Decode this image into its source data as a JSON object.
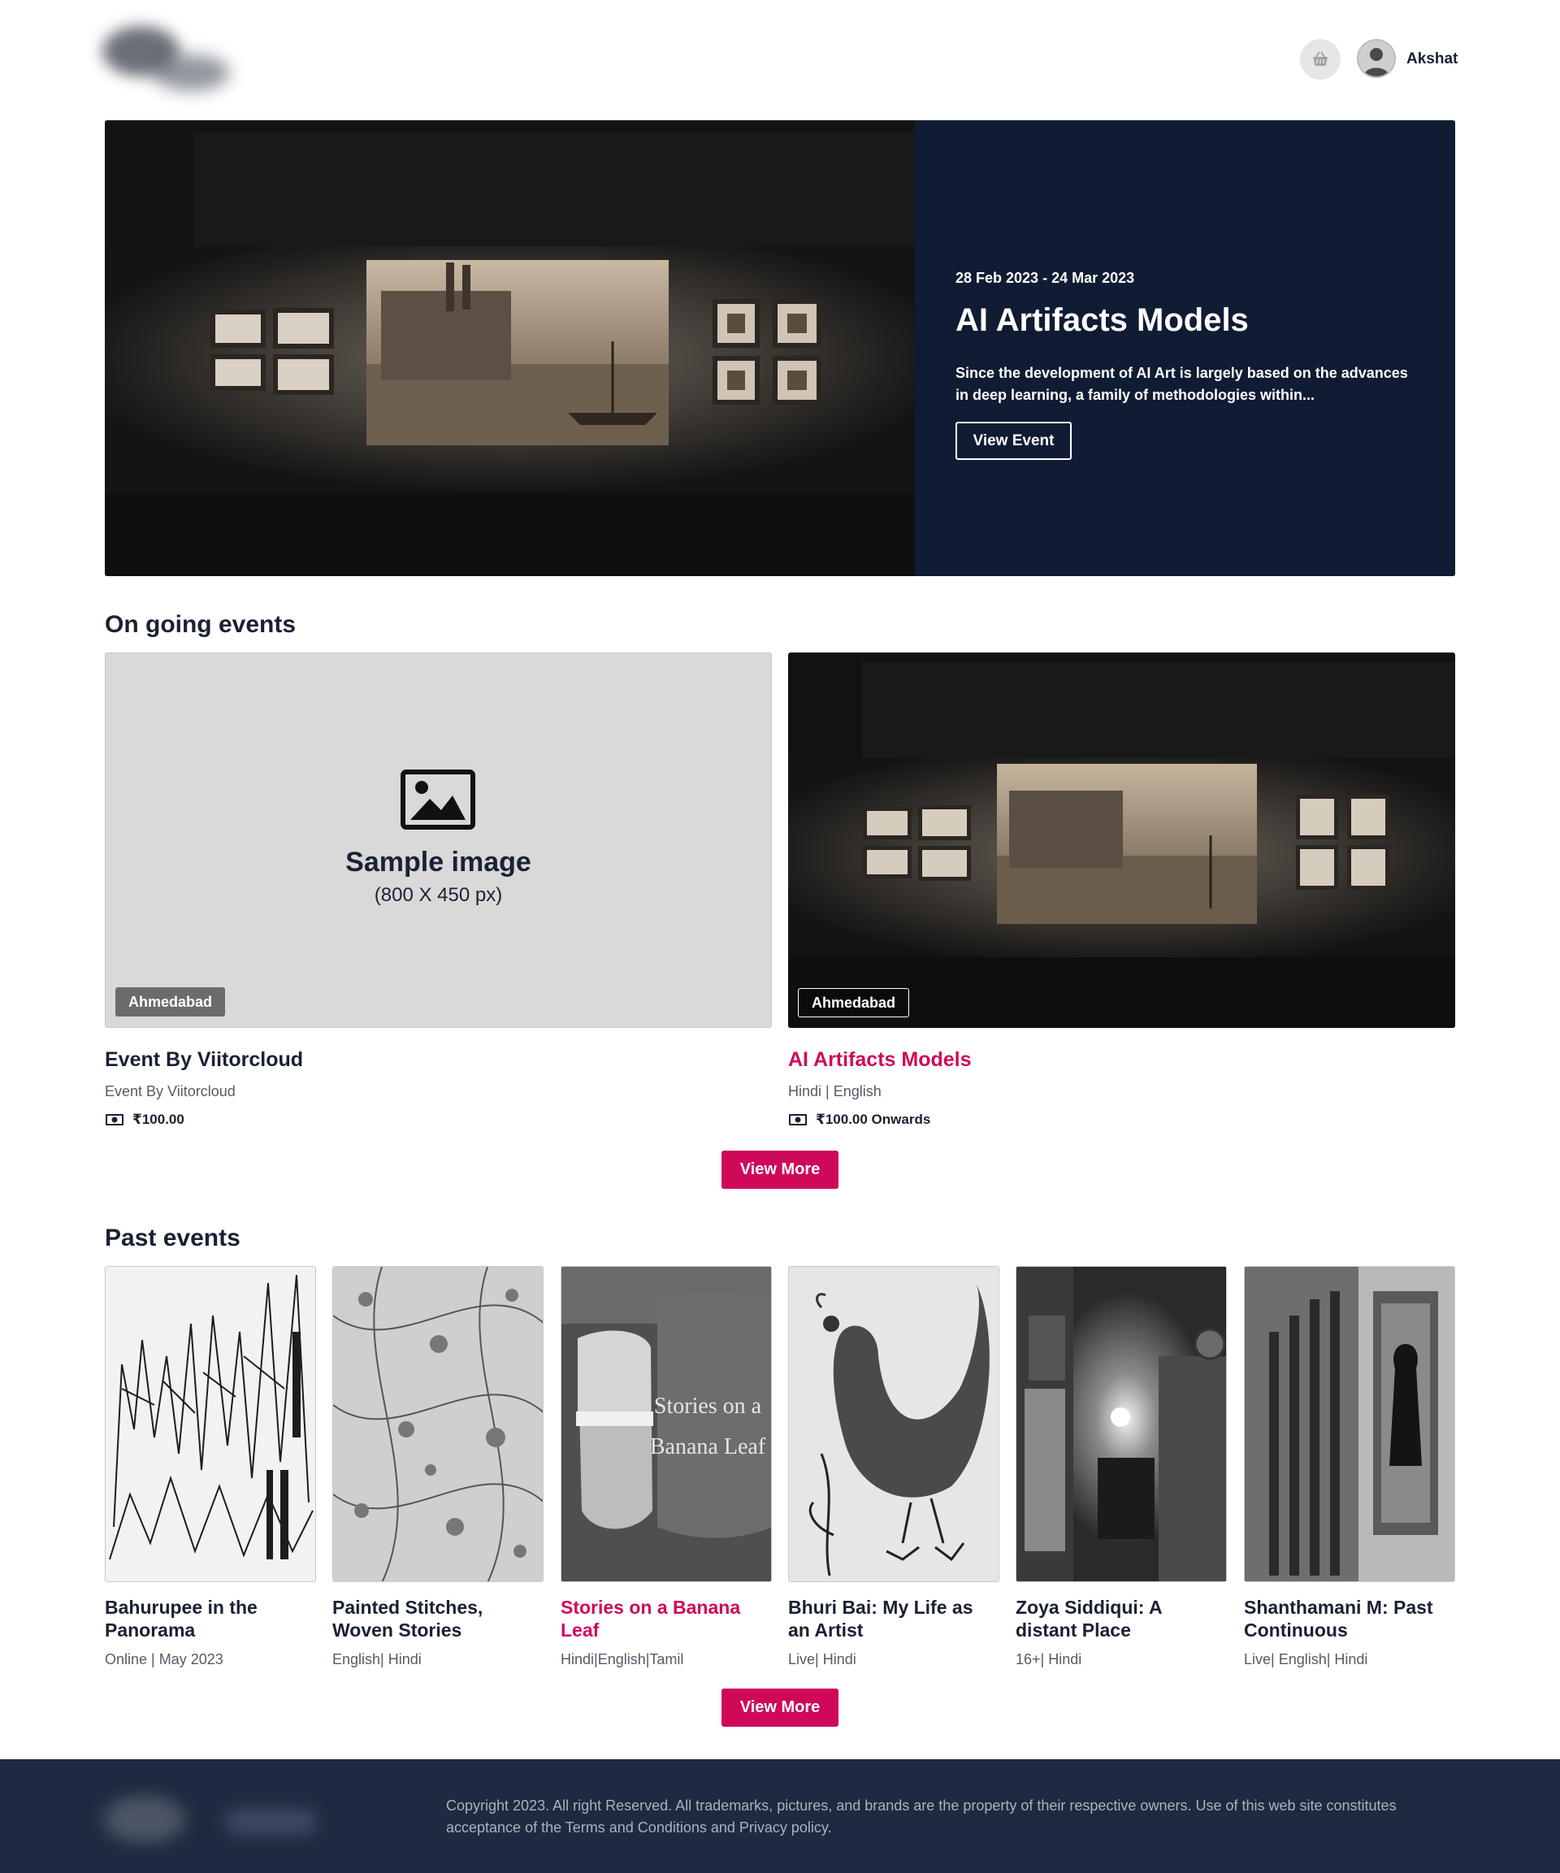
{
  "header": {
    "username": "Akshat",
    "logo_icon": "blurred-logo",
    "cart_icon": "basket-icon",
    "avatar_icon": "user-avatar-icon"
  },
  "hero": {
    "dates": "28 Feb 2023 -  24 Mar 2023",
    "title": "AI Artifacts Models",
    "description": "Since the development of AI Art is largely based on the advances in deep learning, a family of methodologies within...",
    "button_label": "View Event",
    "panel_color": "#0f1c33"
  },
  "ongoing": {
    "heading": "On going events",
    "cards": [
      {
        "placeholder_title": "Sample image",
        "placeholder_sub": "(800 X 450 px)",
        "badge": "Ahmedabad",
        "title": "Event By Viitorcloud",
        "subtitle": "Event By Viitorcloud",
        "price": "₹100.00"
      },
      {
        "badge": "Ahmedabad",
        "title": "AI Artifacts Models",
        "subtitle": "Hindi | English",
        "price": "₹100.00 Onwards"
      }
    ],
    "view_more": "View More"
  },
  "past": {
    "heading": "Past events",
    "cards": [
      {
        "title": "Bahurupee in the Panorama",
        "subtitle": "Online | May 2023"
      },
      {
        "title": "Painted Stitches, Woven Stories",
        "subtitle": "English| Hindi"
      },
      {
        "title": "Stories on a Banana Leaf",
        "subtitle": "Hindi|English|Tamil",
        "image_text": "Stories on a Banana Leaf"
      },
      {
        "title": "Bhuri Bai: My Life as an Artist",
        "subtitle": "Live| Hindi"
      },
      {
        "title": "Zoya Siddiqui: A distant Place",
        "subtitle": "16+| Hindi"
      },
      {
        "title": "Shanthamani M: Past Continuous",
        "subtitle": "Live| English| Hindi"
      }
    ],
    "view_more": "View More"
  },
  "footer": {
    "copyright": "Copyright 2023. All right Reserved. All trademarks, pictures, and brands are the property of their respective owners. Use of this web site constitutes acceptance of the Terms and Conditions and Privacy policy."
  },
  "colors": {
    "accent": "#d0085a",
    "accent_text": "#cf0a5b",
    "navy": "#0f1c33",
    "footer_bg": "#1e2a3f"
  }
}
